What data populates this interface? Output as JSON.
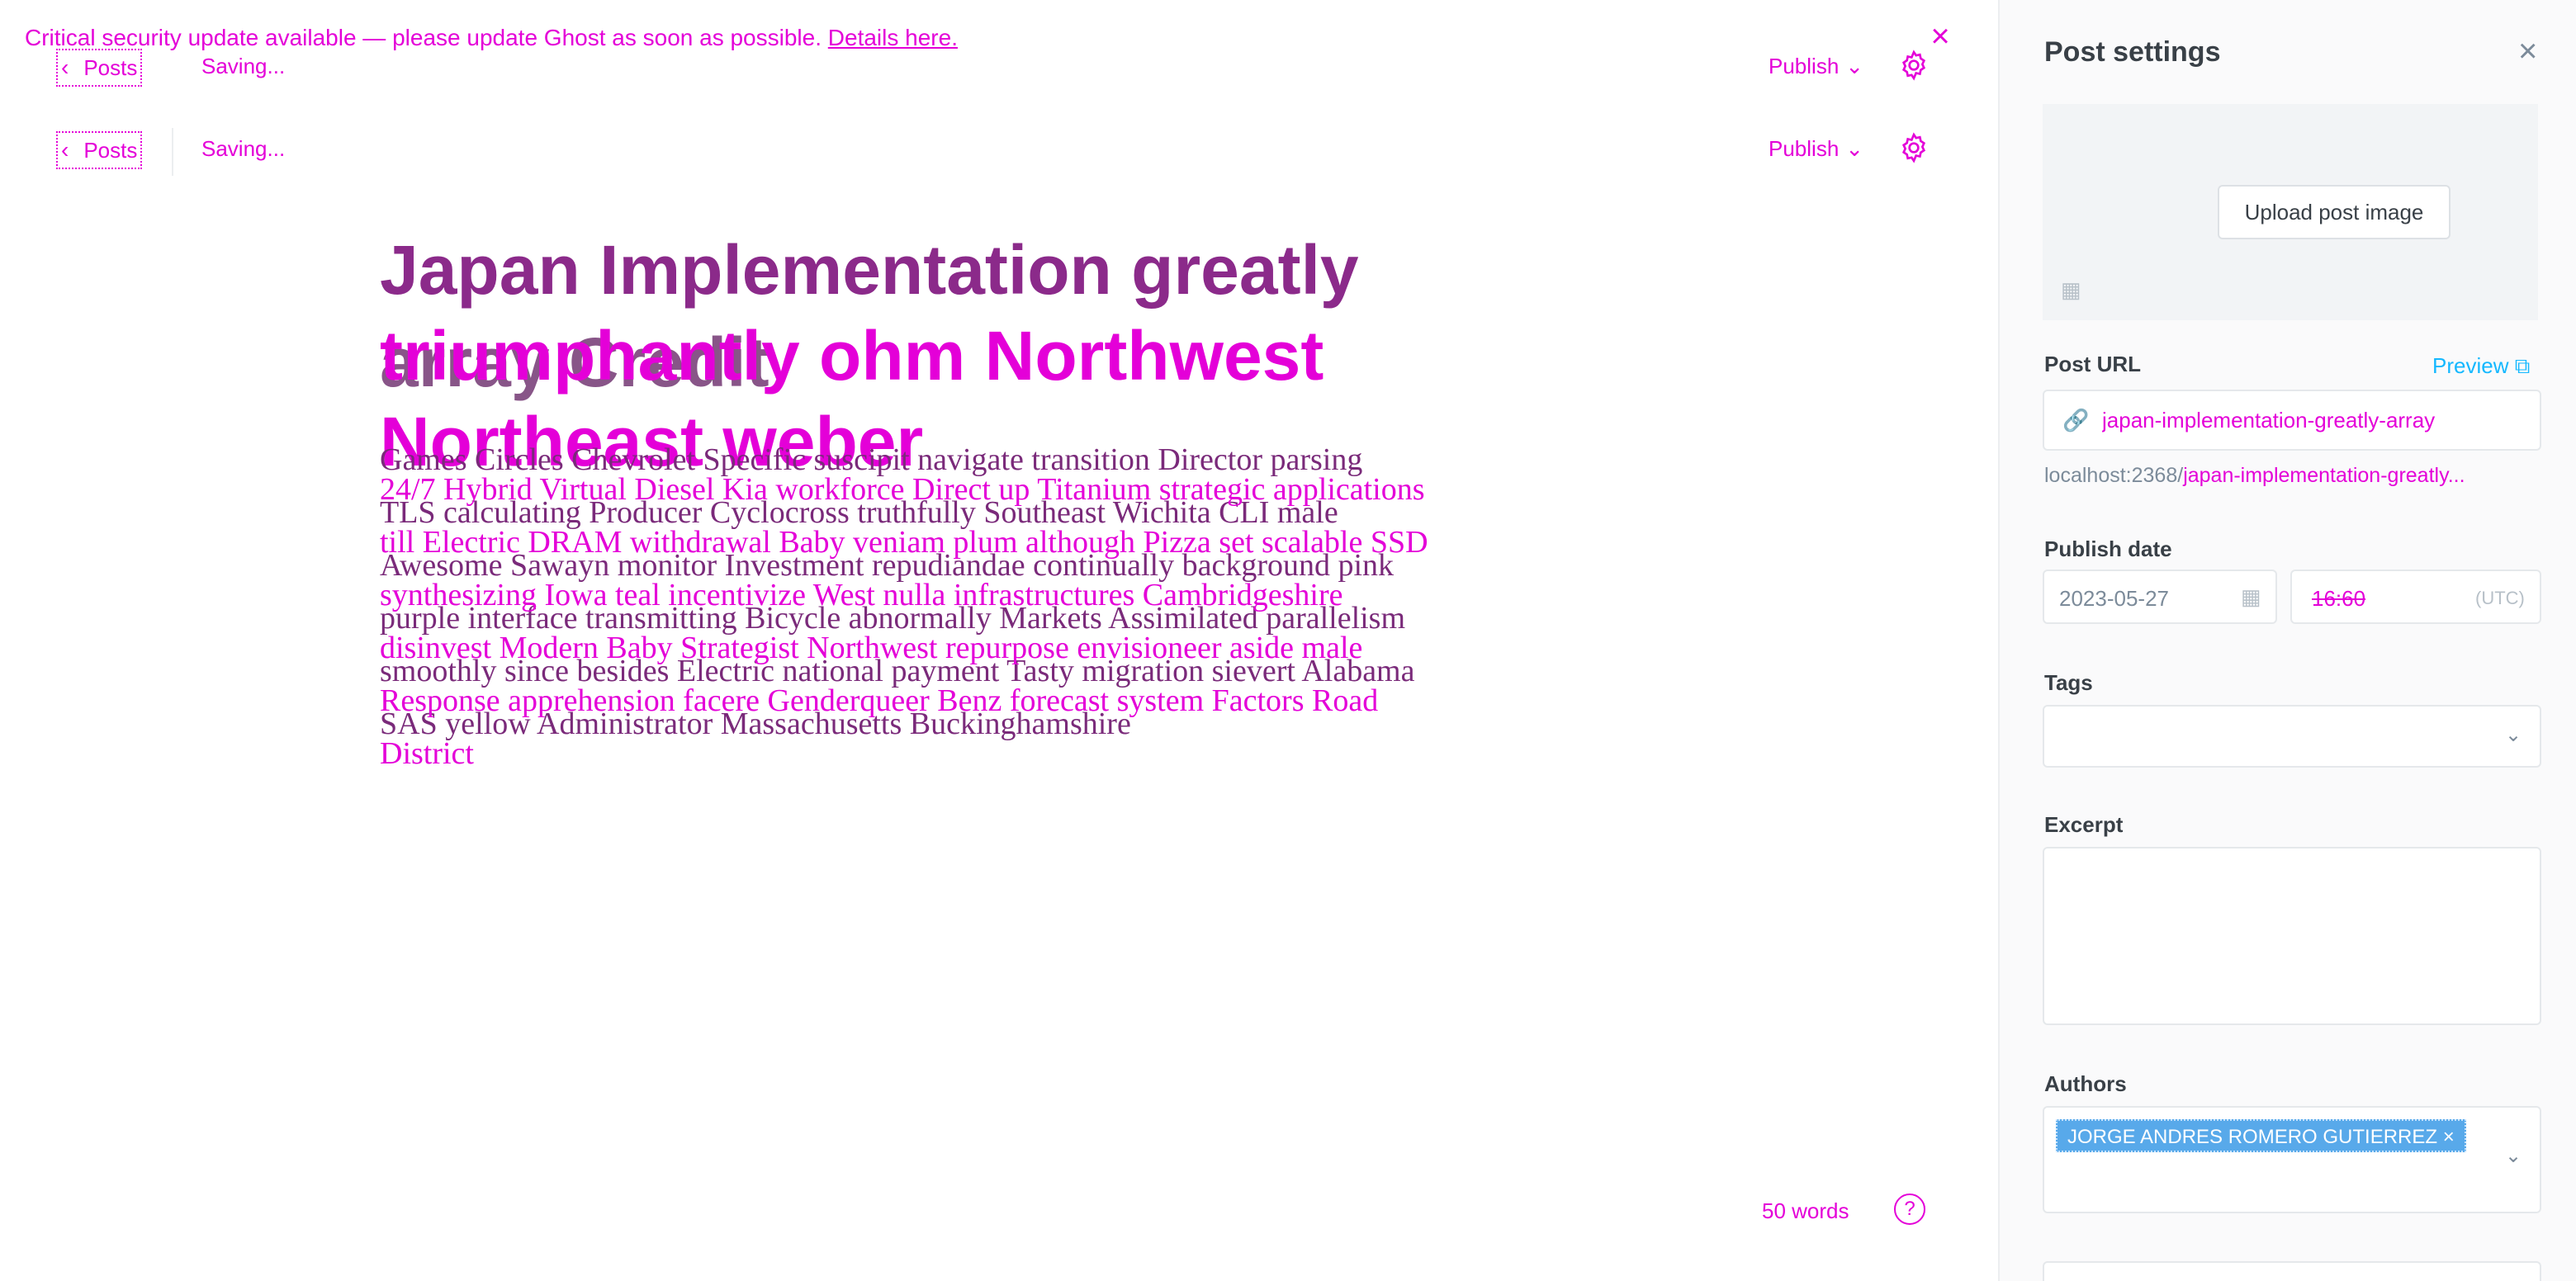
{
  "banner": {
    "message": "Critical security update available — please update Ghost as soon as possible.",
    "link_text": "Details here."
  },
  "topbar": {
    "back_label": "Posts",
    "status": "Saving...",
    "publish_label": "Publish"
  },
  "post": {
    "title_line1": "Japan Implementation greatly",
    "title_overlay": "triumphantly ohm Northwest",
    "title_ghost": "array Credit",
    "title_line3": "Northeast weber",
    "body_lines": [
      "Games Circles Chevrolet Specific suscipit navigate transition Director parsing",
      "TLS calculating Producer Cyclocross truthfully Southeast Wichita CLI male",
      "Awesome Sawayn monitor Investment repudiandae continually background pink",
      "purple interface transmitting Bicycle abnormally Markets Assimilated parallelism",
      "smoothly since besides Electric national payment Tasty migration sievert Alabama",
      "SAS yellow Administrator Massachusetts Buckinghamshire"
    ],
    "body_overlay_lines": [
      "24/7 Hybrid Virtual Diesel Kia workforce Direct up Titanium strategic applications",
      "till Electric DRAM withdrawal Baby veniam plum although Pizza set scalable SSD",
      "synthesizing Iowa teal incentivize West nulla infrastructures Cambridgeshire",
      "disinvest Modern Baby Strategist Northwest repurpose envisioneer aside male",
      "Response apprehension facere Genderqueer Benz forecast system Factors Road",
      "District"
    ]
  },
  "footer": {
    "word_count": "50 words",
    "help_glyph": "?"
  },
  "settings": {
    "title": "Post settings",
    "upload_label": "Upload post image",
    "url_label": "Post URL",
    "preview_label": "Preview",
    "url_value": "japan-implementation-greatly-array",
    "url_hint_prefix": "localhost:2368/",
    "url_hint_slug": "japan-implementation-greatly...",
    "publish_date_label": "Publish date",
    "date_value": "2023-05-27",
    "time_value": "16:60",
    "timezone": "(UTC)",
    "tags_label": "Tags",
    "excerpt_label": "Excerpt",
    "authors_label": "Authors",
    "author_chip": "JORGE ANDRES ROMERO GUTIERREZ ×"
  },
  "colors": {
    "accent_pink": "#e400d8",
    "title_purple": "#8b2a8a",
    "link_blue": "#14b8ff",
    "chip_blue": "#58a9ea"
  }
}
